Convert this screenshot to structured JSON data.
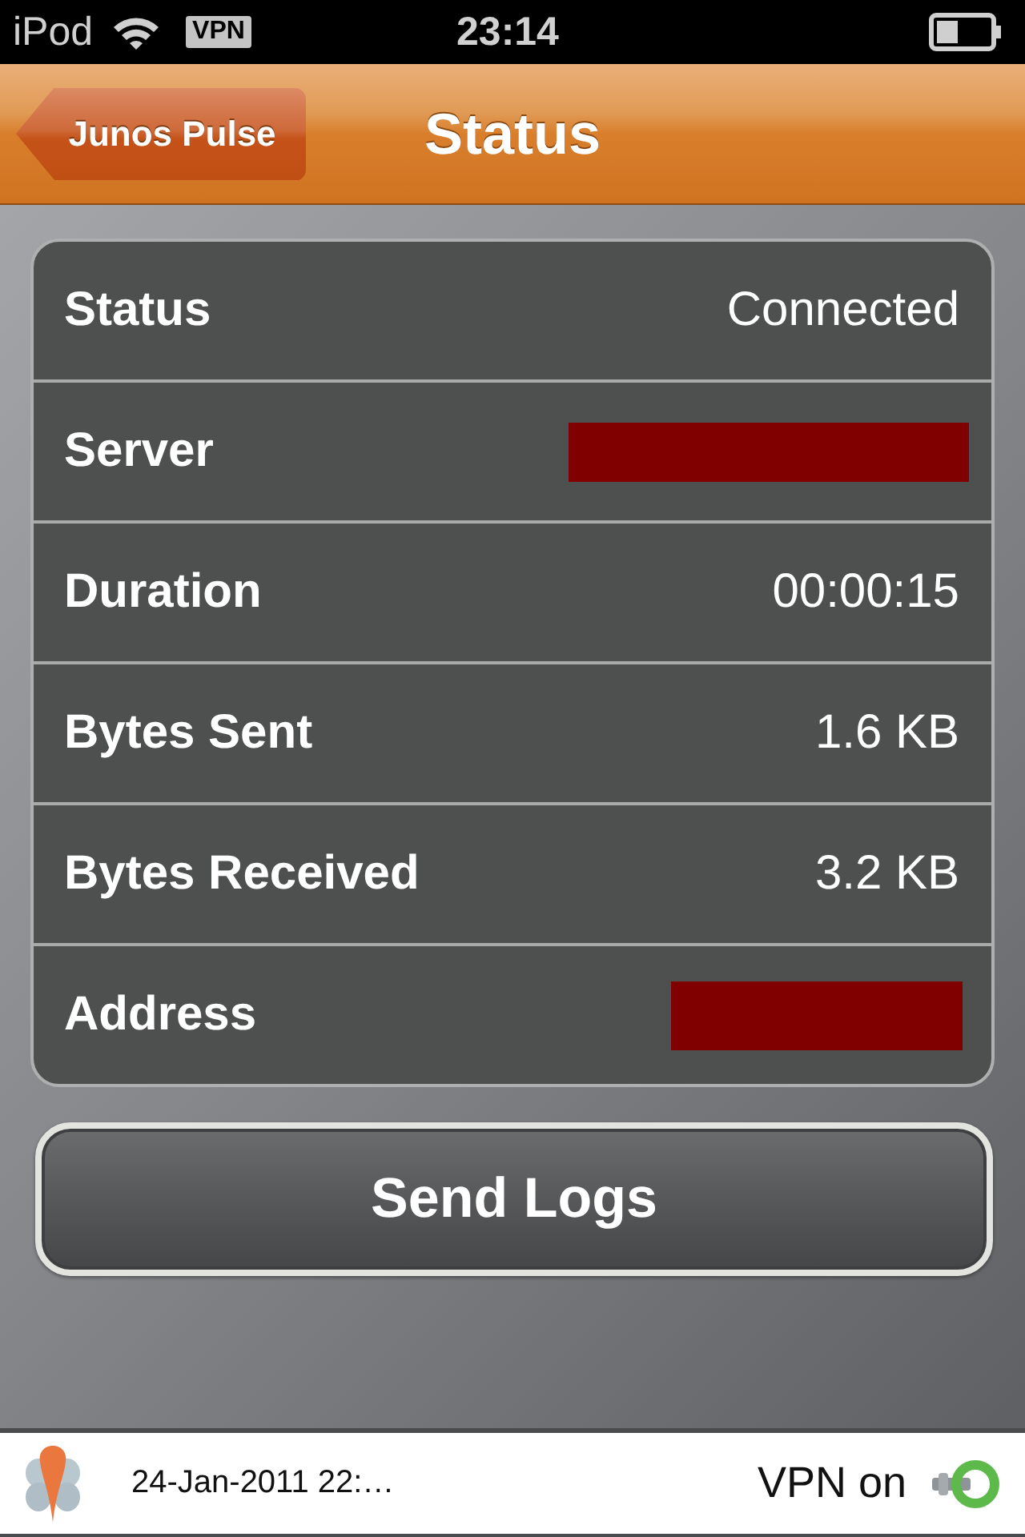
{
  "status_bar": {
    "carrier": "iPod",
    "vpn_badge": "VPN",
    "time": "23:14"
  },
  "nav_bar": {
    "back_button": "Junos Pulse",
    "title": "Status"
  },
  "details": [
    {
      "label": "Status",
      "kind": "text",
      "value": "Connected"
    },
    {
      "label": "Server",
      "kind": "redacted"
    },
    {
      "label": "Duration",
      "kind": "text",
      "value": "00:00:15"
    },
    {
      "label": "Bytes Sent",
      "kind": "text",
      "value": "1.6 KB"
    },
    {
      "label": "Bytes Received",
      "kind": "text",
      "value": "3.2 KB"
    },
    {
      "label": "Address",
      "kind": "redacted"
    }
  ],
  "send_logs_button": "Send Logs",
  "notification_bar": {
    "timestamp": "24-Jan-2011 22:…",
    "vpn_state": "VPN on"
  }
}
